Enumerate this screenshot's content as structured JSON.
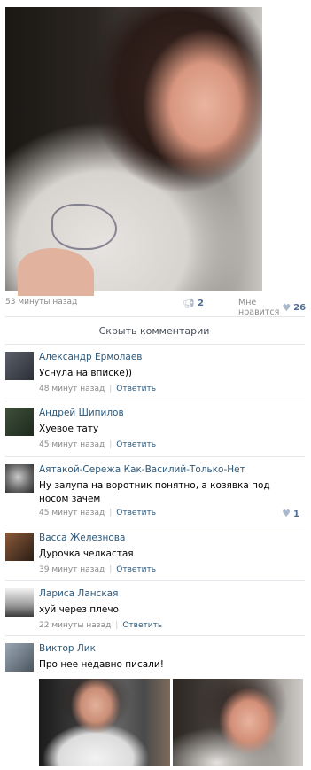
{
  "post": {
    "time": "53 минуты назад",
    "share_count": "2",
    "like_label": "Мне нравится",
    "like_count": "26"
  },
  "hide_comments_label": "Скрыть комментарии",
  "comments": [
    {
      "author": "Александр Ермолаев",
      "text": "Уснула на вписке))",
      "time": "48 минут назад",
      "reply": "Ответить",
      "likes": ""
    },
    {
      "author": "Андрей Шипилов",
      "text": "Хуевое тату",
      "time": "45 минут назад",
      "reply": "Ответить",
      "likes": ""
    },
    {
      "author": "Аятакой-Сережа Как-Василий-Только-Нет",
      "text": "Ну залупа на воротник понятно, а козявка под носом зачем",
      "time": "45 минут назад",
      "reply": "Ответить",
      "likes": "1"
    },
    {
      "author": "Васса Железнова",
      "text": "Дурочка челкастая",
      "time": "39 минут назад",
      "reply": "Ответить",
      "likes": ""
    },
    {
      "author": "Лариса Ланская",
      "text": "хуй через плечо",
      "time": "22 минуты назад",
      "reply": "Ответить",
      "likes": ""
    },
    {
      "author": "Виктор Лик",
      "text": "Про нее недавно писали!",
      "time": "",
      "reply": "",
      "likes": ""
    }
  ],
  "icons": {
    "share": "megaphone-icon",
    "like": "heart-icon"
  },
  "colors": {
    "link": "#2b587a",
    "muted": "#8a8a8a",
    "counter": "#4f6d93"
  }
}
